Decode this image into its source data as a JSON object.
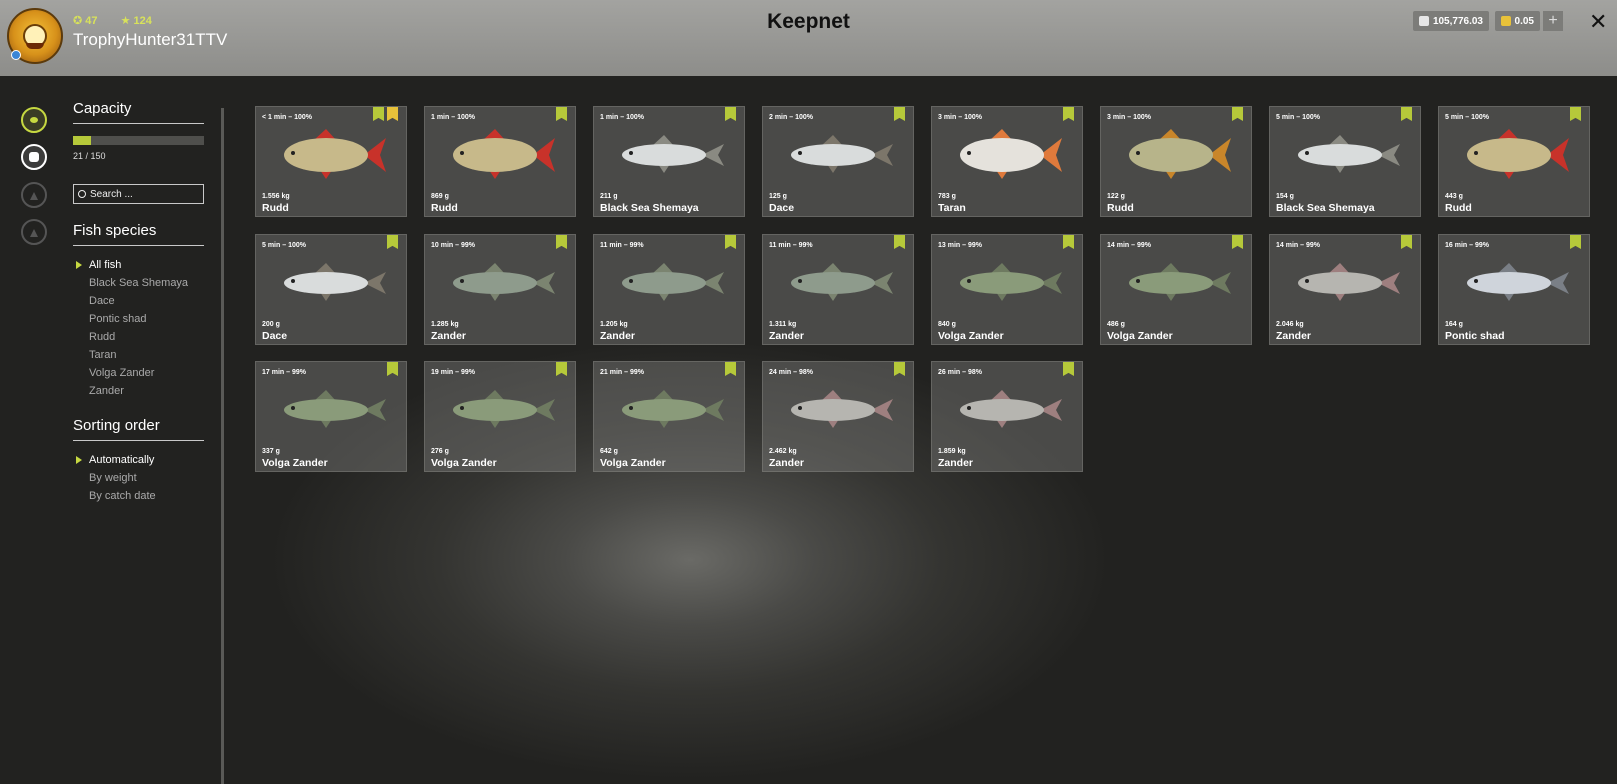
{
  "header": {
    "title": "Keepnet",
    "level": "47",
    "stars": "124",
    "username": "TrophyHunter31TTV",
    "silver": "105,776.03",
    "gold": "0.05",
    "add_label": "+",
    "close_label": "✕"
  },
  "nav": [
    {
      "name": "keepnet-tab-icon",
      "state": "active"
    },
    {
      "name": "fish-bag-tab-icon",
      "state": "white"
    },
    {
      "name": "camp-tab-icon",
      "state": "dim"
    },
    {
      "name": "home-tab-icon",
      "state": "dim"
    }
  ],
  "sidebar": {
    "capacity_title": "Capacity",
    "capacity_count": "21 / 150",
    "capacity_fraction": 0.14,
    "search_placeholder": "Search ...",
    "species_title": "Fish species",
    "species": [
      "All fish",
      "Black Sea Shemaya",
      "Dace",
      "Pontic shad",
      "Rudd",
      "Taran",
      "Volga Zander",
      "Zander"
    ],
    "sorting_title": "Sorting order",
    "sorting": [
      "Automatically",
      "By weight",
      "By catch date"
    ]
  },
  "colors": {
    "accent": "#b6c93a",
    "rudd": "#c7b98a",
    "rudd_fin": "#c8322a",
    "silver": "#d9dcdc",
    "dace_fin": "#7c766a",
    "taran_fin": "#e07a3c",
    "zander": "#8e9b8c",
    "volga": "#8a9b7a"
  },
  "cards": [
    {
      "meta": "< 1 min – 100%",
      "weight": "1.556 kg",
      "name": "Rudd",
      "star": true,
      "fish": "rudd"
    },
    {
      "meta": "1 min – 100%",
      "weight": "869 g",
      "name": "Rudd",
      "star": false,
      "fish": "rudd"
    },
    {
      "meta": "1 min – 100%",
      "weight": "211 g",
      "name": "Black Sea Shemaya",
      "star": false,
      "fish": "shemaya"
    },
    {
      "meta": "2 min – 100%",
      "weight": "125 g",
      "name": "Dace",
      "star": false,
      "fish": "dace"
    },
    {
      "meta": "3 min – 100%",
      "weight": "783 g",
      "name": "Taran",
      "star": false,
      "fish": "taran"
    },
    {
      "meta": "3 min – 100%",
      "weight": "122 g",
      "name": "Rudd",
      "star": false,
      "fish": "rudd2"
    },
    {
      "meta": "5 min – 100%",
      "weight": "154 g",
      "name": "Black Sea Shemaya",
      "star": false,
      "fish": "shemaya"
    },
    {
      "meta": "5 min – 100%",
      "weight": "443 g",
      "name": "Rudd",
      "star": false,
      "fish": "rudd"
    },
    {
      "meta": "5 min – 100%",
      "weight": "200 g",
      "name": "Dace",
      "star": false,
      "fish": "dace"
    },
    {
      "meta": "10 min – 99%",
      "weight": "1.285 kg",
      "name": "Zander",
      "star": false,
      "fish": "zander"
    },
    {
      "meta": "11 min – 99%",
      "weight": "1.205 kg",
      "name": "Zander",
      "star": false,
      "fish": "zander"
    },
    {
      "meta": "11 min – 99%",
      "weight": "1.311 kg",
      "name": "Zander",
      "star": false,
      "fish": "zander"
    },
    {
      "meta": "13 min – 99%",
      "weight": "840 g",
      "name": "Volga Zander",
      "star": false,
      "fish": "volga"
    },
    {
      "meta": "14 min – 99%",
      "weight": "486 g",
      "name": "Volga Zander",
      "star": false,
      "fish": "volga"
    },
    {
      "meta": "14 min – 99%",
      "weight": "2.046 kg",
      "name": "Zander",
      "star": false,
      "fish": "zander2"
    },
    {
      "meta": "16 min – 99%",
      "weight": "164 g",
      "name": "Pontic shad",
      "star": false,
      "fish": "shad"
    },
    {
      "meta": "17 min – 99%",
      "weight": "337 g",
      "name": "Volga Zander",
      "star": false,
      "fish": "volga"
    },
    {
      "meta": "19 min – 99%",
      "weight": "276 g",
      "name": "Volga Zander",
      "star": false,
      "fish": "volga"
    },
    {
      "meta": "21 min – 99%",
      "weight": "642 g",
      "name": "Volga Zander",
      "star": false,
      "fish": "volga"
    },
    {
      "meta": "24 min – 98%",
      "weight": "2.462 kg",
      "name": "Zander",
      "star": false,
      "fish": "zander2"
    },
    {
      "meta": "26 min – 98%",
      "weight": "1.859 kg",
      "name": "Zander",
      "star": false,
      "fish": "zander2"
    }
  ]
}
